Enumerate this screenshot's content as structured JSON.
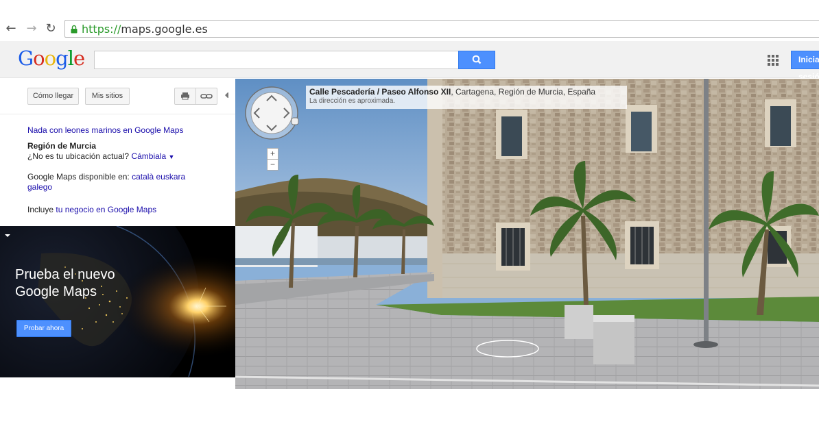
{
  "browser": {
    "url_scheme": "https://",
    "url_host": "maps.google.es",
    "back_icon": "arrow-left-icon",
    "forward_icon": "arrow-right-icon",
    "reload_icon": "reload-icon",
    "lock_icon": "lock-icon"
  },
  "header": {
    "logo": [
      "G",
      "o",
      "o",
      "g",
      "l",
      "e"
    ],
    "logo_colors": [
      "#1a5be8",
      "#d62d20",
      "#e8b60c",
      "#1a5be8",
      "#009925",
      "#d62d20"
    ],
    "search_value": "",
    "search_icon": "search-icon",
    "apps_icon": "apps-grid-icon",
    "signin_label": "Iniciar sesión"
  },
  "sidebar": {
    "directions_label": "Cómo llegar",
    "mysites_label": "Mis sitios",
    "print_icon": "printer-icon",
    "link_icon": "link-icon",
    "promo_link": "Nada con leones marinos en Google Maps",
    "region": "Región de Murcia",
    "location_question": "¿No es tu ubicación actual?",
    "change_link": "Cámbiala",
    "change_arrow": "▼",
    "available_prefix": "Google Maps disponible en:",
    "lang_catala": "català",
    "lang_euskara": "euskara",
    "lang_galego": "galego",
    "include_prefix": "Incluye",
    "include_link": "tu negocio en Google Maps"
  },
  "promo": {
    "title_line1": "Prueba el nuevo",
    "title_line2": "Google Maps",
    "button_label": "Probar ahora"
  },
  "streetview": {
    "street": "Calle Pescadería / Paseo Alfonso XII",
    "locality": ", Cartagena, Región de Murcia, España",
    "note": "La dirección es aproximada.",
    "zoom_in": "+",
    "zoom_out": "−",
    "compass_icon": "navigation-compass-icon"
  }
}
